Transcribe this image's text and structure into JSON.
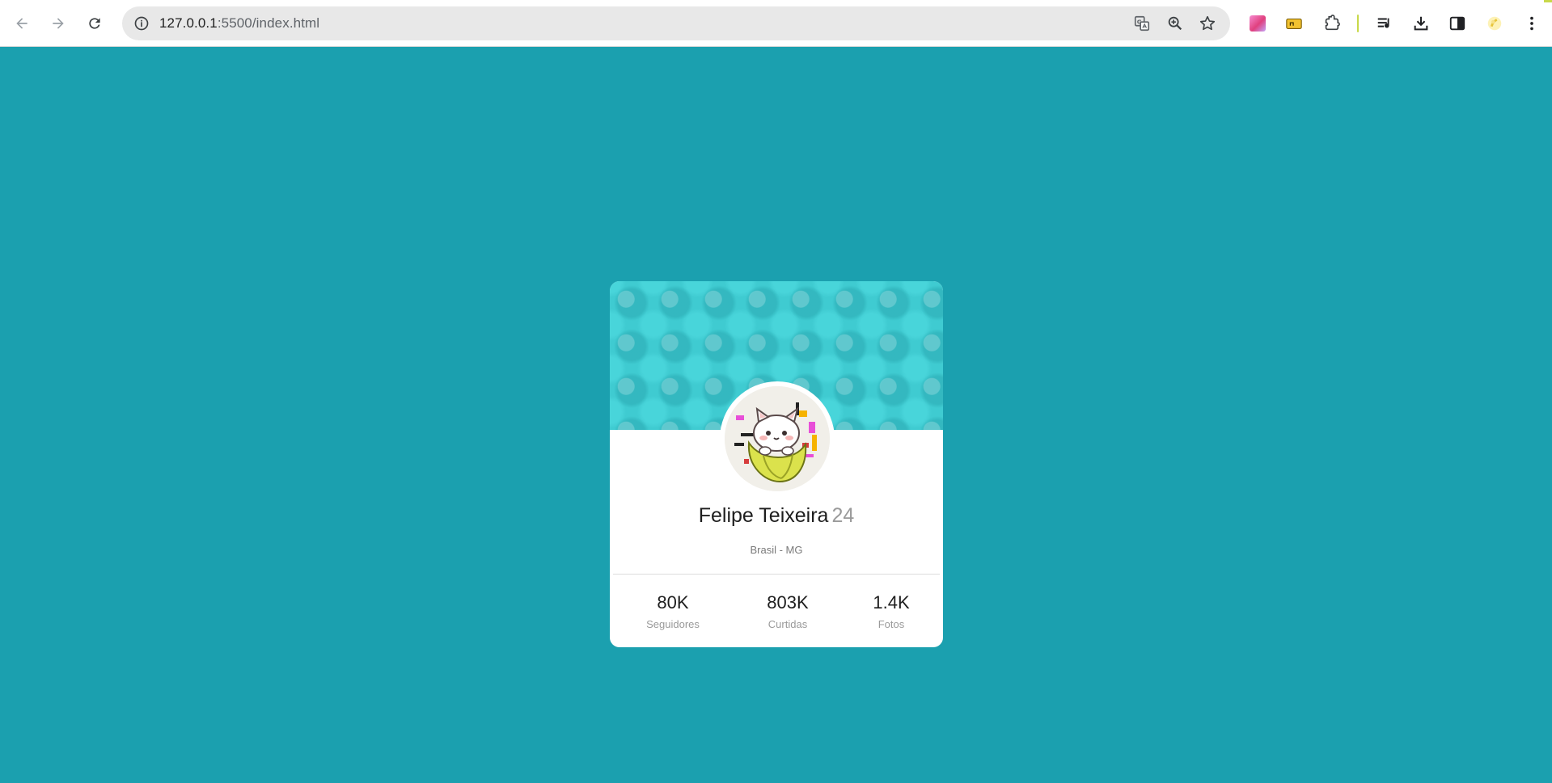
{
  "browser": {
    "url_host": "127.0.0.1",
    "url_path": ":5500/index.html",
    "icons": {
      "back": "back-arrow-icon",
      "forward": "forward-arrow-icon",
      "reload": "reload-icon",
      "site_info": "info-icon",
      "translate": "translate-icon",
      "zoom": "zoom-icon",
      "bookmark": "star-icon",
      "extensions": [
        "gradient-extension-icon",
        "folder-extension-icon",
        "puzzle-icon"
      ],
      "media": "media-queue-icon",
      "downloads": "download-icon",
      "side_panel": "side-panel-icon",
      "profile": "avatar-extension-icon",
      "menu": "kebab-menu-icon"
    }
  },
  "page": {
    "background_color": "#1ba0af",
    "header_color": "#3fcbd1"
  },
  "profile": {
    "name": "Felipe Teixeira",
    "age": "24",
    "location": "Brasil - MG",
    "avatar": "bananya-cat-avatar"
  },
  "stats": [
    {
      "value": "80K",
      "label": "Seguidores"
    },
    {
      "value": "803K",
      "label": "Curtidas"
    },
    {
      "value": "1.4K",
      "label": "Fotos"
    }
  ]
}
